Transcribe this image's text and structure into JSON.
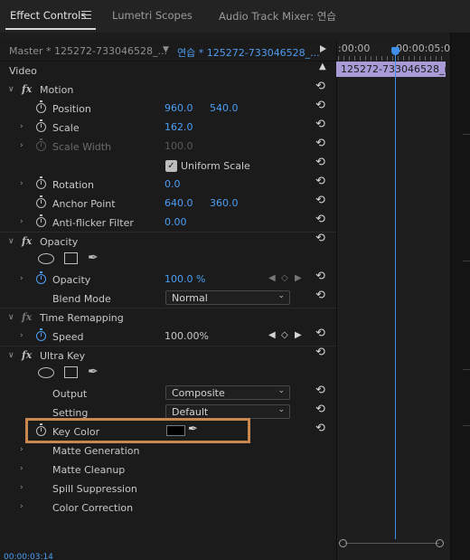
{
  "tabs": [
    {
      "label": "Effect Controls"
    },
    {
      "label": "Lumetri Scopes"
    },
    {
      "label": "Audio Track Mixer: 연습"
    }
  ],
  "header": {
    "master_label": "Master * 125272-733046528_...",
    "sequence_label": "연습 * 125272-733046528_..."
  },
  "timeline": {
    "time_start": ":00:00",
    "time_end": "00:00:05:0",
    "clip_name": "125272-733046528_me"
  },
  "section": {
    "video_label": "Video"
  },
  "effects": {
    "motion": {
      "name": "Motion",
      "position": {
        "label": "Position",
        "x": "960.0",
        "y": "540.0"
      },
      "scale": {
        "label": "Scale",
        "value": "162.0"
      },
      "scale_width": {
        "label": "Scale Width",
        "value": "100.0"
      },
      "uniform_scale": {
        "label": "Uniform Scale",
        "checked": true
      },
      "rotation": {
        "label": "Rotation",
        "value": "0.0"
      },
      "anchor_point": {
        "label": "Anchor Point",
        "x": "640.0",
        "y": "360.0"
      },
      "anti_flicker": {
        "label": "Anti-flicker Filter",
        "value": "0.00"
      }
    },
    "opacity": {
      "name": "Opacity",
      "opacity": {
        "label": "Opacity",
        "value": "100.0 %"
      },
      "blend_mode": {
        "label": "Blend Mode",
        "value": "Normal"
      }
    },
    "time_remapping": {
      "name": "Time Remapping",
      "speed": {
        "label": "Speed",
        "value": "100.00%"
      }
    },
    "ultra_key": {
      "name": "Ultra Key",
      "output": {
        "label": "Output",
        "value": "Composite"
      },
      "setting": {
        "label": "Setting",
        "value": "Default"
      },
      "key_color": {
        "label": "Key Color",
        "color": "#000000"
      },
      "groups": [
        {
          "label": "Matte Generation"
        },
        {
          "label": "Matte Cleanup"
        },
        {
          "label": "Spill Suppression"
        },
        {
          "label": "Color Correction"
        }
      ]
    }
  },
  "status": {
    "timecode": "00:00:03:14"
  },
  "colors": {
    "accent": "#4c9ef4",
    "clip": "#a99ad8",
    "highlight": "#c8874f"
  }
}
